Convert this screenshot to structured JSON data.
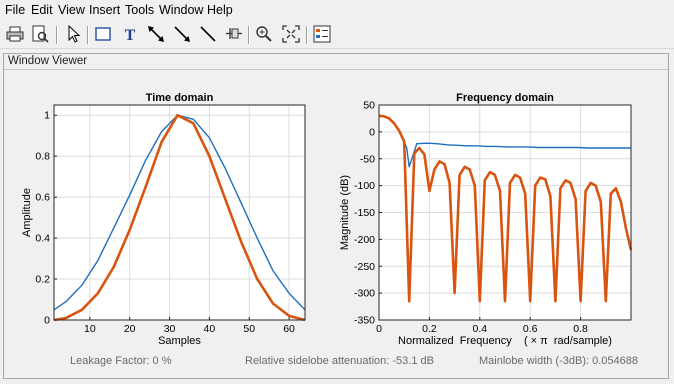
{
  "menubar": {
    "items": [
      "File",
      "Edit",
      "View",
      "Insert",
      "Tools",
      "Window",
      "Help"
    ]
  },
  "toolbar": {
    "buttons": [
      "print-icon",
      "print-preview-icon",
      "select-arrow-icon",
      "rectangle-icon",
      "text-icon",
      "double-arrow-icon",
      "arrow-icon",
      "line-icon",
      "pin-icon",
      "zoom-in-icon",
      "fit-icon",
      "legend-icon"
    ]
  },
  "panel": {
    "title": "Window Viewer"
  },
  "colors": {
    "series1": "#1f6fbf",
    "series2": "#d9540f",
    "grid": "#dcdcdc"
  },
  "chart_data": [
    {
      "type": "line",
      "title": "Time domain",
      "xlabel": "Samples",
      "ylabel": "Amplitude",
      "xlim": [
        1,
        64
      ],
      "ylim": [
        0,
        1.05
      ],
      "xticks": [
        10,
        20,
        30,
        40,
        50,
        60
      ],
      "yticks": [
        0,
        0.2,
        0.4,
        0.6,
        0.8,
        1
      ],
      "ytick_labels": [
        "0",
        "0.2",
        "0.4",
        "0.6",
        "0.8",
        "1"
      ],
      "grid": true,
      "series": [
        {
          "color": "#1f6fbf",
          "x": [
            1,
            4,
            8,
            12,
            16,
            20,
            24,
            28,
            32,
            36,
            40,
            44,
            48,
            52,
            56,
            60,
            64
          ],
          "y": [
            0.05,
            0.09,
            0.17,
            0.29,
            0.45,
            0.61,
            0.78,
            0.92,
            1.0,
            0.98,
            0.89,
            0.74,
            0.57,
            0.4,
            0.24,
            0.13,
            0.05
          ]
        },
        {
          "color": "#d9540f",
          "x": [
            1,
            4,
            8,
            12,
            16,
            20,
            24,
            28,
            32,
            36,
            40,
            44,
            48,
            52,
            56,
            60,
            64
          ],
          "y": [
            0.0,
            0.01,
            0.05,
            0.13,
            0.26,
            0.44,
            0.65,
            0.87,
            1.0,
            0.96,
            0.8,
            0.59,
            0.38,
            0.2,
            0.08,
            0.02,
            0.0
          ]
        }
      ]
    },
    {
      "type": "line",
      "title": "Frequency domain",
      "xlabel": "Normalized  Frequency    ( × π  rad/sample)",
      "ylabel": "Magnitude (dB)",
      "xlim": [
        0,
        1
      ],
      "ylim": [
        -350,
        50
      ],
      "xticks": [
        0,
        0.2,
        0.4,
        0.6,
        0.8
      ],
      "xtick_labels": [
        "0",
        "0.2",
        "0.4",
        "0.6",
        "0.8"
      ],
      "yticks": [
        50,
        0,
        -50,
        -100,
        -150,
        -200,
        -250,
        -300,
        -350
      ],
      "grid": true,
      "series": [
        {
          "color": "#1f6fbf",
          "x": [
            0,
            0.02,
            0.04,
            0.06,
            0.08,
            0.1,
            0.11,
            0.12,
            0.15,
            0.19,
            0.23,
            0.27,
            0.31,
            0.35,
            0.39,
            0.43,
            0.47,
            0.51,
            0.55,
            0.59,
            0.63,
            0.67,
            0.71,
            0.75,
            0.79,
            0.83,
            0.87,
            0.91,
            0.95,
            0.99,
            1.0
          ],
          "y": [
            30,
            29,
            25,
            16,
            2,
            -18,
            -30,
            -65,
            -22,
            -21,
            -22,
            -24,
            -25,
            -26,
            -26,
            -27,
            -27,
            -28,
            -28,
            -28,
            -29,
            -29,
            -29,
            -29,
            -29,
            -30,
            -30,
            -30,
            -30,
            -30,
            -30
          ]
        },
        {
          "color": "#d9540f",
          "x": [
            0,
            0.02,
            0.04,
            0.06,
            0.08,
            0.1,
            0.12,
            0.14,
            0.16,
            0.18,
            0.2,
            0.22,
            0.24,
            0.26,
            0.28,
            0.3,
            0.32,
            0.34,
            0.36,
            0.38,
            0.4,
            0.42,
            0.44,
            0.46,
            0.48,
            0.5,
            0.52,
            0.54,
            0.56,
            0.58,
            0.6,
            0.62,
            0.64,
            0.66,
            0.68,
            0.7,
            0.72,
            0.74,
            0.76,
            0.78,
            0.8,
            0.82,
            0.84,
            0.86,
            0.88,
            0.9,
            0.92,
            0.94,
            0.96,
            0.98,
            1.0
          ],
          "y": [
            30,
            29,
            25,
            16,
            2,
            -18,
            -315,
            -40,
            -30,
            -42,
            -110,
            -70,
            -55,
            -60,
            -95,
            -300,
            -80,
            -65,
            -70,
            -100,
            -315,
            -90,
            -75,
            -80,
            -110,
            -315,
            -95,
            -80,
            -85,
            -115,
            -315,
            -100,
            -85,
            -88,
            -120,
            -315,
            -105,
            -90,
            -95,
            -125,
            -315,
            -110,
            -95,
            -100,
            -130,
            -315,
            -115,
            -105,
            -130,
            -180,
            -220
          ]
        }
      ]
    }
  ],
  "status": {
    "leakage": "Leakage Factor: 0 %",
    "sidelobe": "Relative sidelobe attenuation: -53.1 dB",
    "mainlobe": "Mainlobe width (-3dB): 0.054688"
  }
}
